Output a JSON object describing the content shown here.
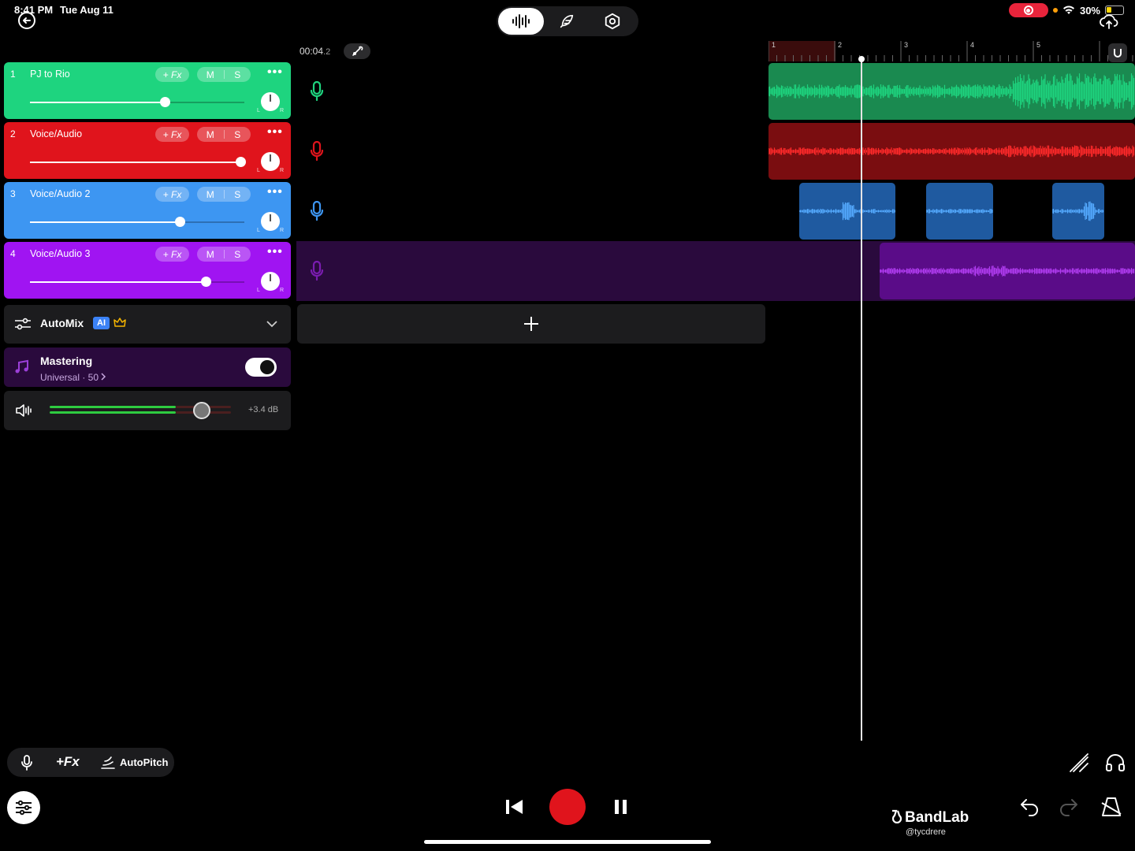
{
  "status_bar": {
    "time": "8:41 PM",
    "date": "Tue Aug 11",
    "battery": "30%"
  },
  "top_bar": {
    "modes": [
      {
        "icon": "waveform-icon"
      },
      {
        "icon": "feather-icon"
      },
      {
        "icon": "hexagon-settings-icon"
      }
    ],
    "active_mode": 0
  },
  "timeline": {
    "time_main": "00:04",
    "time_frac": ".2",
    "ruler_ticks": [
      "1",
      "2",
      "3",
      "4",
      "5"
    ],
    "snap_icon": "magnet-icon"
  },
  "tracks": [
    {
      "num": "1",
      "name": "PJ to Rio",
      "fx": "+ Fx",
      "mute": "M",
      "solo": "S",
      "color": "#1ed47f",
      "clip_color": "#1a8a50",
      "wave_color": "#1ed47f",
      "volume": 0.63
    },
    {
      "num": "2",
      "name": "Voice/Audio",
      "fx": "+ Fx",
      "mute": "M",
      "solo": "S",
      "color": "#e0141c",
      "clip_color": "#7a0d10",
      "wave_color": "#ff2a2a",
      "volume": 0.98
    },
    {
      "num": "3",
      "name": "Voice/Audio 2",
      "fx": "+ Fx",
      "mute": "M",
      "solo": "S",
      "color": "#3d96f2",
      "clip_color": "#1f5aa0",
      "wave_color": "#55aaff",
      "volume": 0.7
    },
    {
      "num": "4",
      "name": "Voice/Audio 3",
      "fx": "+ Fx",
      "mute": "M",
      "solo": "S",
      "color": "#a014f2",
      "clip_color": "#5a0c88",
      "wave_color": "#b03cf0",
      "volume": 0.82
    }
  ],
  "pan_labels": {
    "left": "L",
    "right": "R"
  },
  "automix": {
    "label": "AutoMix",
    "badge": "AI"
  },
  "mastering": {
    "title": "Mastering",
    "subtitle": "Universal · 50",
    "enabled": true
  },
  "master_volume": {
    "db_label": "+3.4 dB"
  },
  "bottom_tools": {
    "fx": "+Fx",
    "autopitch": "AutoPitch"
  },
  "brand": {
    "name": "BandLab",
    "handle": "@tycdrere"
  }
}
